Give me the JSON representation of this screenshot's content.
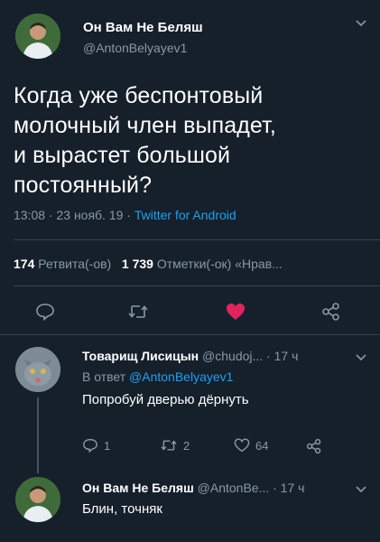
{
  "tweet": {
    "author_name": "Он Вам Не Беляш",
    "author_handle": "@AntonBelyayev1",
    "text_lines": [
      "Когда уже беспонтовый",
      "молочный член выпадет,",
      "и вырастет большой",
      "постоянный?"
    ],
    "time": "13:08 · 23 нояб. 19 · ",
    "source": "Twitter for Android",
    "retweets_count": "174",
    "retweets_label": "Ретвита(-ов)",
    "likes_count": "1 739",
    "likes_label": "Отметки(-ок) «Нрав..."
  },
  "reply1": {
    "name": "Товарищ Лисицын",
    "handle": "@chudoj... · 17 ч",
    "in_reply_prefix": "В ответ ",
    "in_reply_handle": "@AntonBelyayev1",
    "text": "Попробуй дверью дёрнуть",
    "reply_count": "1",
    "retweet_count": "2",
    "like_count": "64"
  },
  "reply2": {
    "name": "Он Вам Не Беляш",
    "handle": "@AntonBe... · 17 ч",
    "text": "Блин, точняк"
  },
  "colors": {
    "background": "#15202b",
    "accent": "#1da1f2",
    "like": "#e0245e",
    "muted": "#8899a6"
  }
}
